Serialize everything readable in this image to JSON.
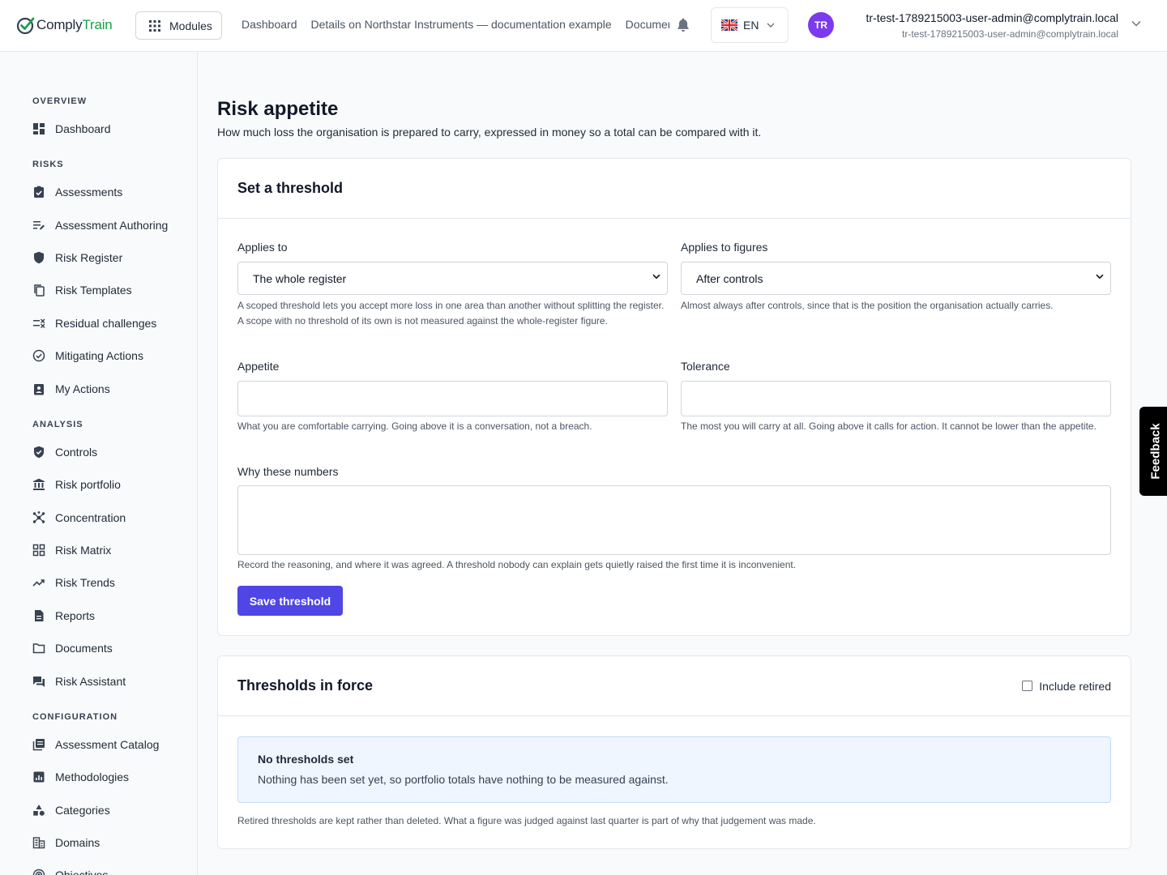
{
  "app": {
    "name_part1": "Comply",
    "name_part2": "Train"
  },
  "header": {
    "modules_label": "Modules",
    "breadcrumbs": [
      "Dashboard",
      "Details on Northstar Instruments — documentation example",
      "Documentation"
    ],
    "language": "EN",
    "avatar_initials": "TR",
    "user_name": "tr-test-1789215003-user-admin@complytrain.local",
    "user_email": "tr-test-1789215003-user-admin@complytrain.local"
  },
  "sidebar": {
    "sections": {
      "overview": "OVERVIEW",
      "risks": "RISKS",
      "analysis": "ANALYSIS",
      "configuration": "CONFIGURATION"
    },
    "items": {
      "dashboard": "Dashboard",
      "assessments": "Assessments",
      "assessment_authoring": "Assessment Authoring",
      "risk_register": "Risk Register",
      "risk_templates": "Risk Templates",
      "residual_challenges": "Residual challenges",
      "mitigating_actions": "Mitigating Actions",
      "my_actions": "My Actions",
      "controls": "Controls",
      "risk_portfolio": "Risk portfolio",
      "concentration": "Concentration",
      "risk_matrix": "Risk Matrix",
      "risk_trends": "Risk Trends",
      "reports": "Reports",
      "documents": "Documents",
      "risk_assistant": "Risk Assistant",
      "assessment_catalog": "Assessment Catalog",
      "methodologies": "Methodologies",
      "categories": "Categories",
      "domains": "Domains",
      "objectives": "Objectives"
    }
  },
  "page": {
    "title": "Risk appetite",
    "subtitle": "How much loss the organisation is prepared to carry, expressed in money so a total can be compared with it."
  },
  "threshold_form": {
    "heading": "Set a threshold",
    "applies_to_label": "Applies to",
    "applies_to_value": "The whole register",
    "applies_to_help": "A scoped threshold lets you accept more loss in one area than another without splitting the register. A scope with no threshold of its own is not measured against the whole-register figure.",
    "figures_label": "Applies to figures",
    "figures_value": "After controls",
    "figures_help": "Almost always after controls, since that is the position the organisation actually carries.",
    "appetite_label": "Appetite",
    "appetite_value": "",
    "appetite_help": "What you are comfortable carrying. Going above it is a conversation, not a breach.",
    "tolerance_label": "Tolerance",
    "tolerance_value": "",
    "tolerance_help": "The most you will carry at all. Going above it calls for action. It cannot be lower than the appetite.",
    "why_label": "Why these numbers",
    "why_value": "",
    "why_help": "Record the reasoning, and where it was agreed. A threshold nobody can explain gets quietly raised the first time it is inconvenient.",
    "save_label": "Save threshold"
  },
  "thresholds_in_force": {
    "heading": "Thresholds in force",
    "include_retired_label": "Include retired",
    "include_retired_checked": false,
    "empty_title": "No thresholds set",
    "empty_text": "Nothing has been set yet, so portfolio totals have nothing to be measured against.",
    "footnote": "Retired thresholds are kept rather than deleted. What a figure was judged against last quarter is part of why that judgement was made."
  },
  "feedback_label": "Feedback",
  "colors": {
    "primary": "#4f46e5",
    "brand_green": "#16a34a",
    "avatar": "#7c3aed",
    "info_bg": "#eff6ff"
  }
}
